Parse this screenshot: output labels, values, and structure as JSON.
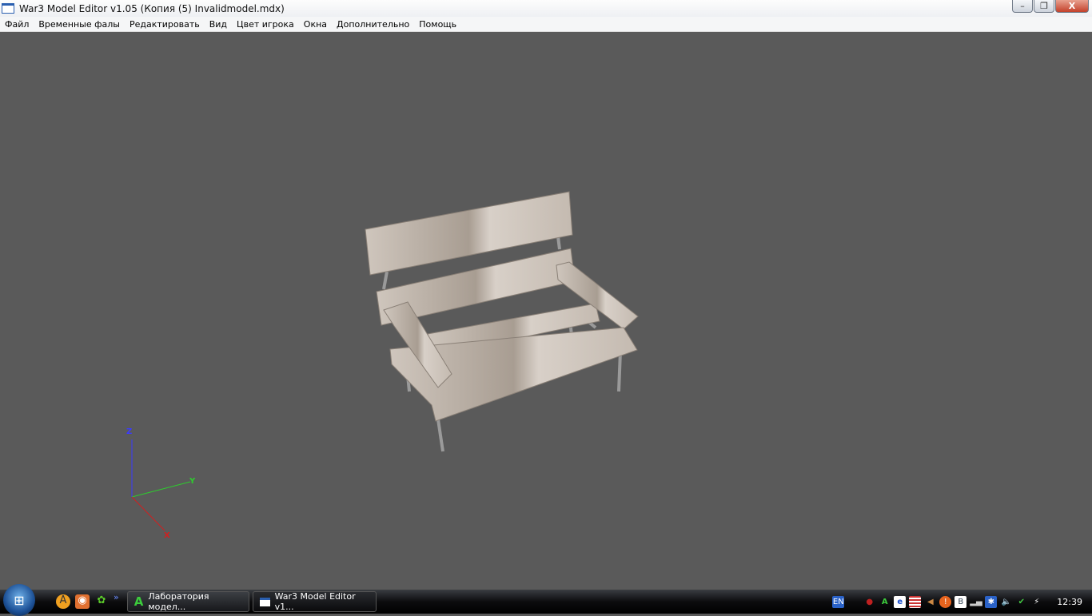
{
  "window": {
    "title": "War3 Model Editor v1.05 (Копия (5) Invalidmodel.mdx)",
    "controls": {
      "minimize": "–",
      "maximize": "❐",
      "close": "X"
    }
  },
  "menu": [
    "Файл",
    "Временные фалы",
    "Редактировать",
    "Вид",
    "Цвет игрока",
    "Окна",
    "Дополнительно",
    "Помощь"
  ],
  "viewport": {
    "axes": {
      "z": "Z",
      "y": "Y",
      "x": "X"
    },
    "background": "#5a5a5a"
  },
  "taskbar": {
    "quick_launch": [
      "aimp-icon",
      "eye-icon",
      "icq-icon"
    ],
    "more": "»",
    "buttons": [
      {
        "label": "Лаборатория модел...",
        "icon": "A"
      },
      {
        "label": "War3 Model Editor v1..."
      }
    ],
    "tray": {
      "language": "EN",
      "clock": "12:39"
    }
  }
}
